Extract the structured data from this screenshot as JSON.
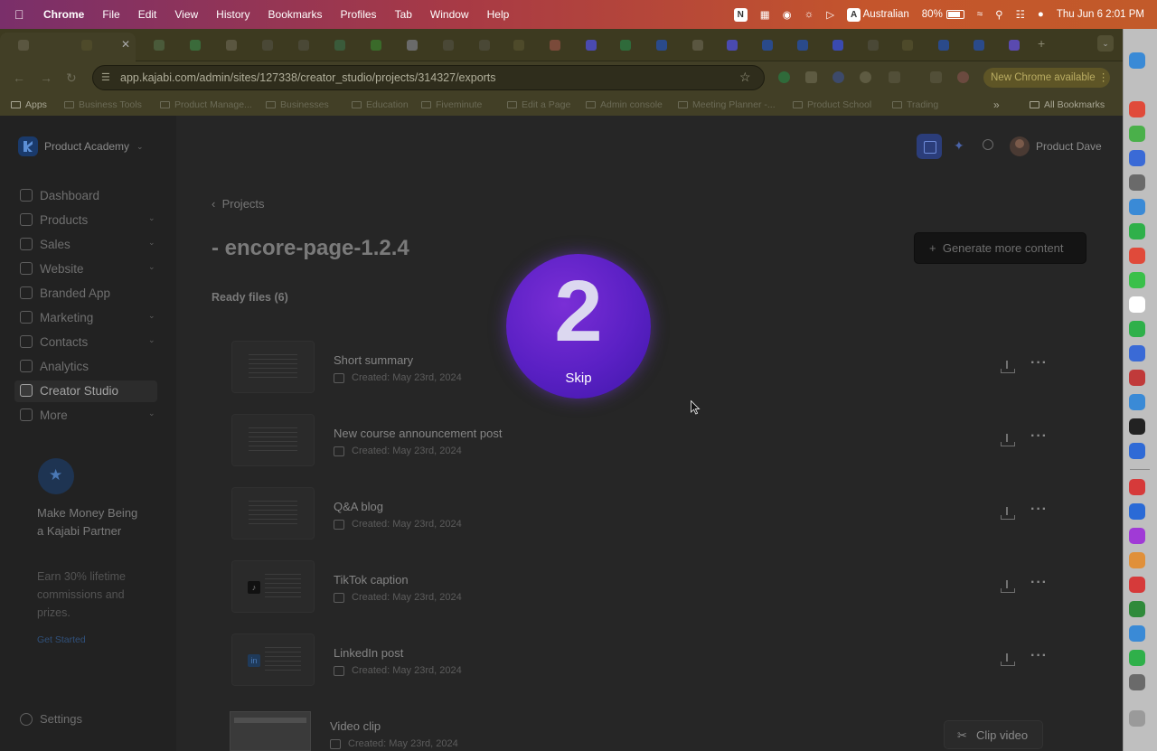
{
  "menubar": {
    "items": [
      "Chrome",
      "File",
      "Edit",
      "View",
      "History",
      "Bookmarks",
      "Profiles",
      "Tab",
      "Window",
      "Help"
    ],
    "input_source": "Australian",
    "battery": "80%",
    "battery_level": 0.8,
    "clock": "Thu Jun 6  2:01 PM",
    "notion_badge": "N",
    "input_badge": "A"
  },
  "browser": {
    "url": "app.kajabi.com/admin/sites/127338/creator_studio/projects/314327/exports",
    "update_label": "New Chrome available",
    "bookmarks": [
      "Apps",
      "Business Tools",
      "Product Manage...",
      "Businesses",
      "Education",
      "Fiveminute",
      "Edit a Page",
      "Admin console",
      "Meeting Planner -...",
      "Product School",
      "Trading"
    ],
    "all_bookmarks": "All Bookmarks"
  },
  "app": {
    "site_name": "Product Academy",
    "user_name": "Product Dave",
    "nav": [
      {
        "label": "Dashboard",
        "has_children": false
      },
      {
        "label": "Products",
        "has_children": true
      },
      {
        "label": "Sales",
        "has_children": true
      },
      {
        "label": "Website",
        "has_children": true
      },
      {
        "label": "Branded App",
        "has_children": false
      },
      {
        "label": "Marketing",
        "has_children": true
      },
      {
        "label": "Contacts",
        "has_children": true
      },
      {
        "label": "Analytics",
        "has_children": false
      },
      {
        "label": "Creator Studio",
        "has_children": false,
        "active": true
      },
      {
        "label": "More",
        "has_children": true
      }
    ],
    "promo": {
      "title": "Make Money Being a Kajabi Partner",
      "body": "Earn 30% lifetime commissions and prizes.",
      "link": "Get Started"
    },
    "settings_label": "Settings"
  },
  "main": {
    "breadcrumb": "Projects",
    "title": "- encore-page-1.2.4",
    "generate_button": "Generate more content",
    "section_label": "Ready files (6)",
    "files": [
      {
        "name": "Short summary",
        "date": "Created: May 23rd, 2024"
      },
      {
        "name": "New course announcement post",
        "date": "Created: May 23rd, 2024"
      },
      {
        "name": "Q&A blog",
        "date": "Created: May 23rd, 2024"
      },
      {
        "name": "TikTok caption",
        "date": "Created: May 23rd, 2024"
      },
      {
        "name": "LinkedIn post",
        "date": "Created: May 23rd, 2024"
      },
      {
        "name": "Video clip",
        "date": "Created: May 23rd, 2024"
      }
    ],
    "clip_button": "Clip video"
  },
  "overlay": {
    "count": "2",
    "skip_label": "Skip"
  },
  "colors": {
    "accent": "#5a20c4",
    "kajabi_blue": "#2b3d7a"
  }
}
